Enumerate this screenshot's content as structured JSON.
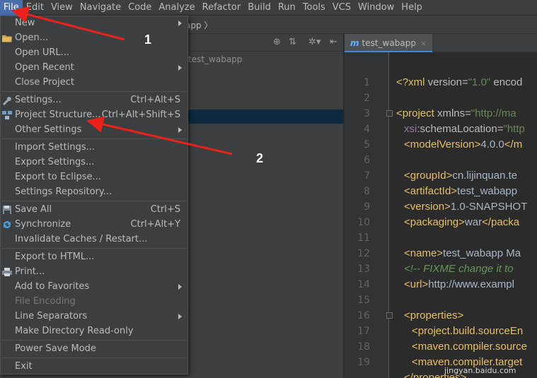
{
  "menubar": {
    "items": [
      {
        "label": "File",
        "active": true
      },
      {
        "label": "Edit"
      },
      {
        "label": "View"
      },
      {
        "label": "Navigate"
      },
      {
        "label": "Code"
      },
      {
        "label": "Analyze"
      },
      {
        "label": "Refactor"
      },
      {
        "label": "Build"
      },
      {
        "label": "Run"
      },
      {
        "label": "Tools"
      },
      {
        "label": "VCS"
      },
      {
        "label": "Window"
      },
      {
        "label": "Help"
      }
    ]
  },
  "navbar": {
    "crumb": "app"
  },
  "project": {
    "root_label": "test_wabapp"
  },
  "editor": {
    "tab": {
      "icon": "m",
      "label": "test_wabapp",
      "close": "×"
    },
    "line_numbers": [
      "1",
      "2",
      "3",
      "4",
      "5",
      "6",
      "7",
      "8",
      "9",
      "10",
      "11",
      "12",
      "13",
      "14",
      "15",
      "16",
      "17",
      "18",
      "19"
    ]
  },
  "file_menu": {
    "items": [
      {
        "label": "New",
        "submenu": true
      },
      {
        "label": "Open...",
        "icon": "folder-icon"
      },
      {
        "label": "Open URL..."
      },
      {
        "label": "Open Recent",
        "submenu": true
      },
      {
        "label": "Close Project"
      },
      {
        "label": "Settings...",
        "shortcut": "Ctrl+Alt+S",
        "icon": "wrench-icon"
      },
      {
        "label": "Project Structure...",
        "shortcut": "Ctrl+Alt+Shift+S",
        "icon": "project-structure-icon"
      },
      {
        "label": "Other Settings",
        "submenu": true
      },
      {
        "label": "Import Settings..."
      },
      {
        "label": "Export Settings..."
      },
      {
        "label": "Export to Eclipse..."
      },
      {
        "label": "Settings Repository..."
      },
      {
        "label": "Save All",
        "shortcut": "Ctrl+S",
        "icon": "save-icon"
      },
      {
        "label": "Synchronize",
        "shortcut": "Ctrl+Alt+Y",
        "icon": "sync-icon"
      },
      {
        "label": "Invalidate Caches / Restart..."
      },
      {
        "label": "Export to HTML..."
      },
      {
        "label": "Print...",
        "icon": "print-icon"
      },
      {
        "label": "Add to Favorites",
        "submenu": true
      },
      {
        "label": "File Encoding",
        "disabled": true
      },
      {
        "label": "Line Separators",
        "submenu": true
      },
      {
        "label": "Make Directory Read-only"
      },
      {
        "label": "Power Save Mode"
      },
      {
        "label": "Exit"
      }
    ]
  },
  "annotations": {
    "marker1": "1",
    "marker2": "2",
    "watermark": "jingyan.baidu.com"
  },
  "colors": {
    "menu_bg": "#3c3f41",
    "editor_bg": "#2b2b2b",
    "selection": "#4b6eaf",
    "arrow": "#e8221b"
  }
}
